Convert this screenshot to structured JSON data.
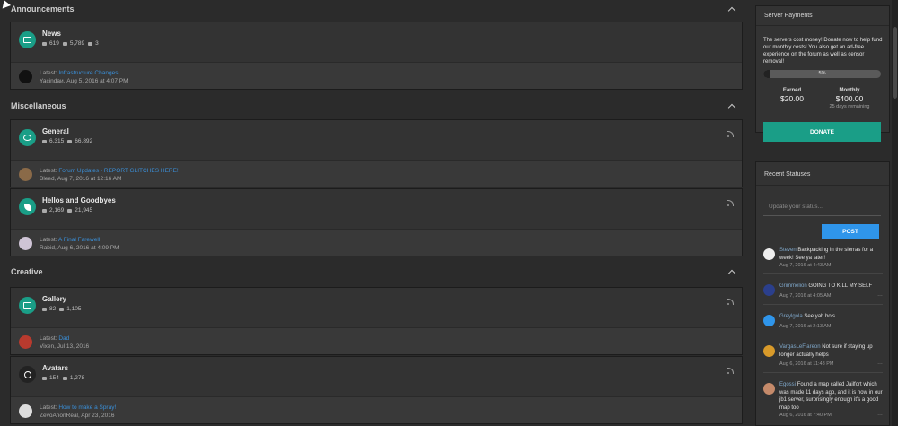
{
  "categories": [
    {
      "title": "Announcements"
    },
    {
      "title": "Miscellaneous"
    },
    {
      "title": "Creative"
    }
  ],
  "forums": [
    {
      "name": "News",
      "stat1": "619",
      "stat2": "5,789",
      "stat3": "3",
      "latest_prefix": "Latest:",
      "latest_title": "Infrastructure Changes",
      "latest_meta": "Yacindaи, Aug 5, 2016 at 4:07 PM",
      "icon": "newspaper-icon",
      "icon_color": "#1a9e87"
    },
    {
      "name": "General",
      "stat1": "6,315",
      "stat2": "66,892",
      "latest_prefix": "Latest:",
      "latest_title": "Forum Updates - REPORT GLITCHES HERE!",
      "latest_meta": "Bleed, Aug 7, 2016 at 12:16 AM",
      "icon": "chat-bubble-icon",
      "icon_color": "#1a9e87"
    },
    {
      "name": "Hellos and Goodbyes",
      "stat1": "2,169",
      "stat2": "21,945",
      "latest_prefix": "Latest:",
      "latest_title": "A Final Farewell",
      "latest_meta": "Rabid, Aug 6, 2016 at 4:09 PM",
      "icon": "leaf-icon",
      "icon_color": "#1a9e87"
    },
    {
      "name": "Gallery",
      "stat1": "82",
      "stat2": "1,105",
      "latest_prefix": "Latest:",
      "latest_title": "Dad",
      "latest_meta": "Vixen, Jul 13, 2016",
      "icon": "image-icon",
      "icon_color": "#1a9e87"
    },
    {
      "name": "Avatars",
      "stat1": "154",
      "stat2": "1,278",
      "latest_prefix": "Latest:",
      "latest_title": "How to make a Spray!",
      "latest_meta": "ZevoAnonReal, Apr 23, 2016",
      "icon": "smiley-icon",
      "icon_color": "#222222"
    }
  ],
  "payments": {
    "title": "Server Payments",
    "text": "The servers cost money! Donate now to help fund our monthly costs! You also get an ad-free experience on the forum as well as censor removal!",
    "progress_label": "5%",
    "progress": 0.05,
    "earned_label": "Earned",
    "earned_value": "$20.00",
    "monthly_label": "Monthly",
    "monthly_value": "$400.00",
    "remaining": "25 days remaining",
    "donate_label": "DONATE"
  },
  "statuses": {
    "title": "Recent Statuses",
    "placeholder": "Update your status...",
    "post_label": "POST",
    "items": [
      {
        "user": "Steven",
        "text": "Backpacking in the sierras for a week! See ya later!",
        "meta": "Aug 7, 2016 at 4:43 AM",
        "dots": "…"
      },
      {
        "user": "Grimmelion",
        "text": "GOING TO KILL MY SELF",
        "meta": "Aug 7, 2016 at 4:05 AM",
        "dots": "…"
      },
      {
        "user": "Greylgola",
        "text": "See yah bois",
        "meta": "Aug 7, 2016 at 2:13 AM",
        "dots": "…"
      },
      {
        "user": "VargasLeFlareon",
        "text": "Not sure if staying up longer actually helps",
        "meta": "Aug 6, 2016 at 11:48 PM",
        "dots": "…"
      },
      {
        "user": "Egossi",
        "text": "Found a map called Jailfort which was made 11 days ago, and it is now in our jb1 server, surprisingly enough it's a good map too",
        "meta": "Aug 6, 2016 at 7:40 PM",
        "dots": "…"
      }
    ]
  }
}
